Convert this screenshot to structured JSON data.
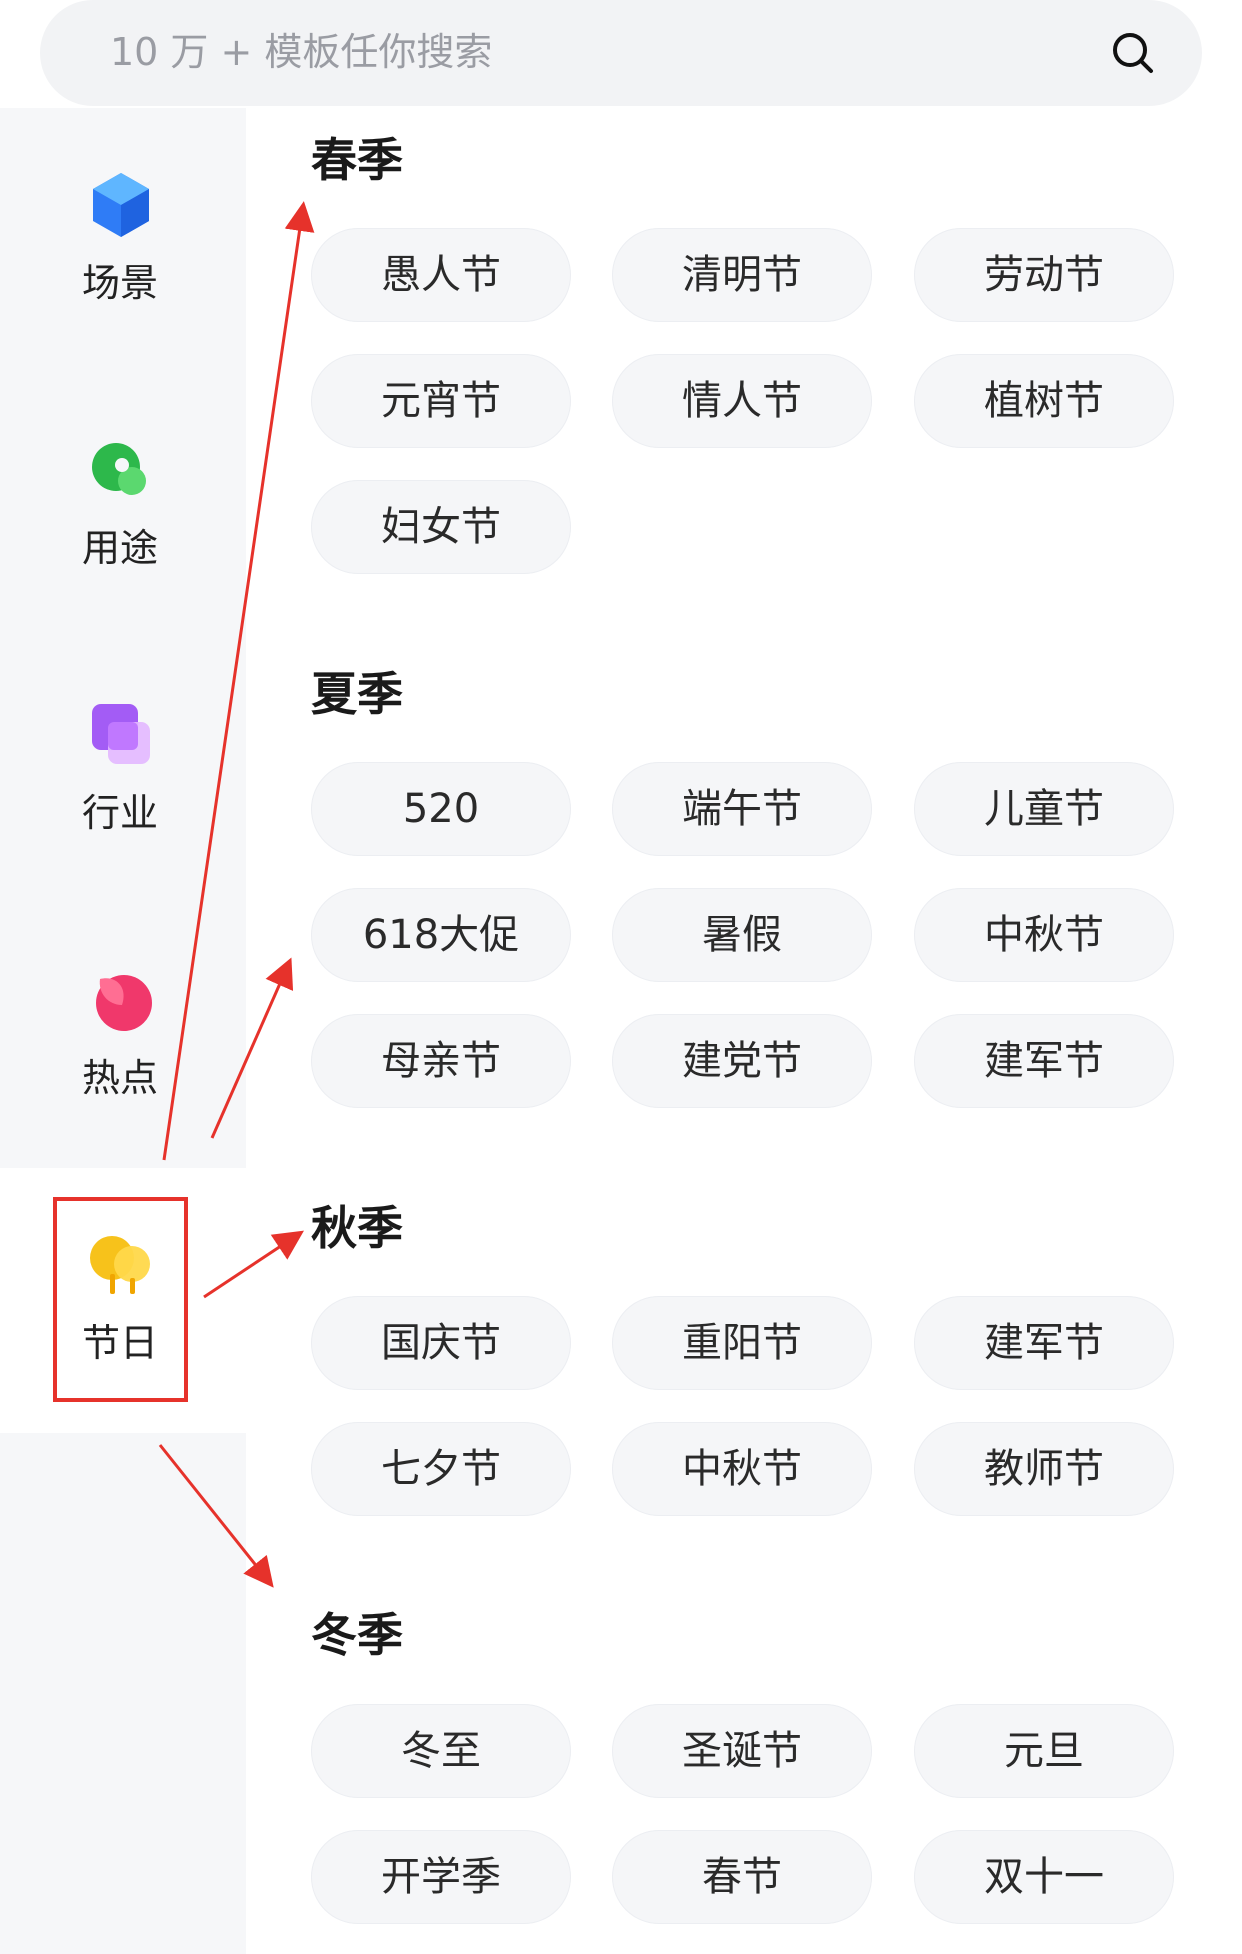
{
  "search": {
    "placeholder": "10 万 + 模板任你搜索"
  },
  "sidebar": {
    "items": [
      {
        "label": "场景",
        "icon": "hexagon-icon",
        "color": "#2f7cf6"
      },
      {
        "label": "用途",
        "icon": "leaf-icon",
        "color": "#2db84b"
      },
      {
        "label": "行业",
        "icon": "stacked-squares-icon",
        "color": "#a35cf5"
      },
      {
        "label": "热点",
        "icon": "flame-icon",
        "color": "#f0386b"
      },
      {
        "label": "节日",
        "icon": "trees-icon",
        "color": "#f7c21b"
      }
    ],
    "active_index": 4
  },
  "sections": [
    {
      "title": "春季",
      "tags": [
        "愚人节",
        "清明节",
        "劳动节",
        "元宵节",
        "情人节",
        "植树节",
        "妇女节"
      ]
    },
    {
      "title": "夏季",
      "tags": [
        "520",
        "端午节",
        "儿童节",
        "618大促",
        "暑假",
        "中秋节",
        "母亲节",
        "建党节",
        "建军节"
      ]
    },
    {
      "title": "秋季",
      "tags": [
        "国庆节",
        "重阳节",
        "建军节",
        "七夕节",
        "中秋节",
        "教师节"
      ]
    },
    {
      "title": "冬季",
      "tags": [
        "冬至",
        "圣诞节",
        "元旦",
        "开学季",
        "春节",
        "双十一"
      ]
    }
  ],
  "annotation_color": "#e6322b"
}
